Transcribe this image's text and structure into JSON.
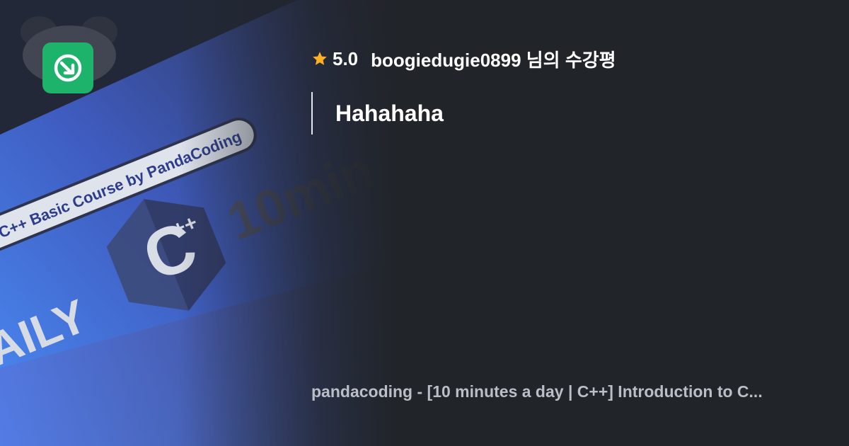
{
  "thumbnail": {
    "banner_text": "C++ Basic Course by PandaCoding",
    "big_text": "10min",
    "daily_text": "AILY",
    "logo_glyph": "C",
    "logo_superscript": "++"
  },
  "brand": {
    "icon": "inflearn-logo-icon",
    "color": "#1DB36B"
  },
  "review": {
    "star_icon": "star-icon",
    "star_color": "#FDB022",
    "score": "5.0",
    "reviewer_line": "boogiedugie0899 님의 수강평",
    "text": "Hahahaha"
  },
  "course": {
    "title": "pandacoding - [10 minutes a day | C++] Introduction to C..."
  }
}
